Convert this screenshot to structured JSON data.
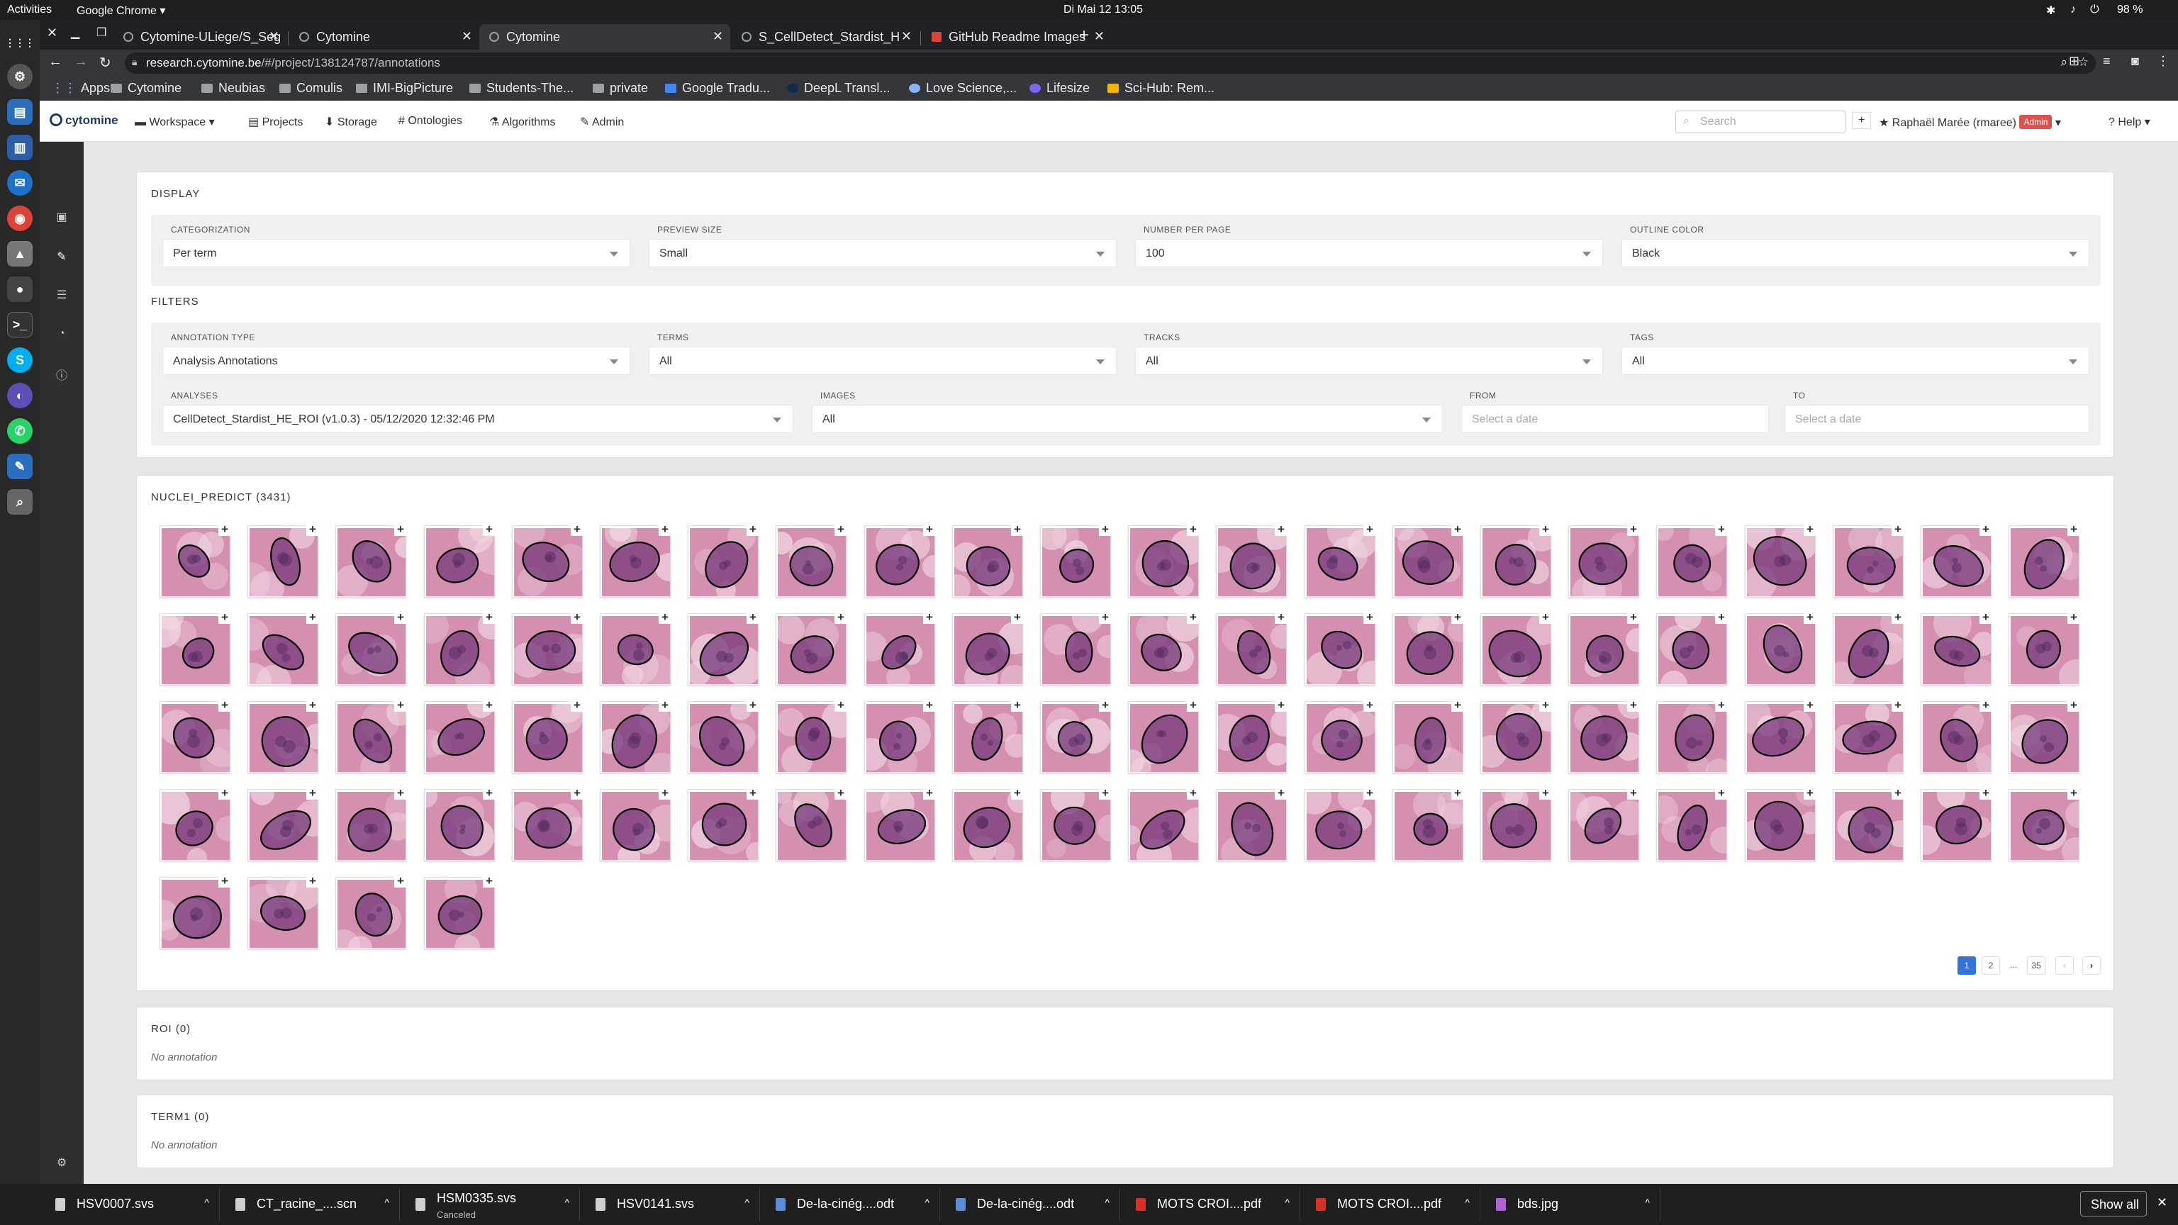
{
  "system_bar": {
    "activities": "Activities",
    "app": "Google Chrome",
    "clock": "Di Mai 12  13:05",
    "battery": "98 %"
  },
  "dock": {
    "icons": [
      "launcher-icon",
      "settings-icon",
      "files-icon",
      "thunderbird-icon",
      "chrome-icon",
      "inkscape-icon",
      "maps-icon",
      "terminal-icon",
      "skype-icon",
      "eclipse-icon",
      "whatsapp-icon",
      "editor-icon",
      "screenshot-icon"
    ]
  },
  "tabs": [
    {
      "title": "Cytomine-ULiege/S_Seg",
      "active": false
    },
    {
      "title": "Cytomine",
      "active": false
    },
    {
      "title": "Cytomine",
      "active": true
    },
    {
      "title": "S_CellDetect_Stardist_H",
      "active": false
    },
    {
      "title": "GitHub Readme Images",
      "active": false
    }
  ],
  "url": {
    "host": "research.cytomine.be",
    "path": "/#/project/138124787/annotations"
  },
  "bookmarks": [
    "Apps",
    "Cytomine",
    "Neubias",
    "Comulis",
    "IMI-BigPicture",
    "Students-The...",
    "private",
    "Google Tradu...",
    "DeepL Transl...",
    "Love Science,...",
    "Lifesize",
    "Sci-Hub: Rem..."
  ],
  "navbar": {
    "logo": "cytomine",
    "items": [
      "Workspace",
      "Projects",
      "Storage",
      "Ontologies",
      "Algorithms",
      "Admin"
    ],
    "search_placeholder": "Search",
    "user": "Raphaël Marée (rmaree)",
    "admin_badge": "Admin",
    "help": "Help"
  },
  "display": {
    "title": "DISPLAY",
    "categorization": {
      "label": "CATEGORIZATION",
      "value": "Per term"
    },
    "preview_size": {
      "label": "PREVIEW SIZE",
      "value": "Small"
    },
    "number_per_page": {
      "label": "NUMBER PER PAGE",
      "value": "100"
    },
    "outline_color": {
      "label": "OUTLINE COLOR",
      "value": "Black"
    }
  },
  "filters": {
    "title": "FILTERS",
    "annotation_type": {
      "label": "ANNOTATION TYPE",
      "value": "Analysis Annotations"
    },
    "terms": {
      "label": "TERMS",
      "value": "All"
    },
    "tracks": {
      "label": "TRACKS",
      "value": "All"
    },
    "tags": {
      "label": "TAGS",
      "value": "All"
    },
    "analyses": {
      "label": "ANALYSES",
      "value": "CellDetect_Stardist_HE_ROI (v1.0.3) - 05/12/2020 12:32:46 PM"
    },
    "images": {
      "label": "IMAGES",
      "value": "All"
    },
    "from": {
      "label": "FROM",
      "placeholder": "Select a date"
    },
    "to": {
      "label": "TO",
      "placeholder": "Select a date"
    }
  },
  "nuclei": {
    "title": "NUCLEI_PREDICT (3431)",
    "thumbnail_count": 92,
    "pagination": [
      "1",
      "2",
      "...",
      "35"
    ]
  },
  "roi": {
    "title": "ROI (0)",
    "empty": "No annotation"
  },
  "term1": {
    "title": "TERM1 (0)",
    "empty": "No annotation"
  },
  "downloads": [
    {
      "name": "HSV0007.svs",
      "status": ""
    },
    {
      "name": "CT_racine_....scn",
      "status": ""
    },
    {
      "name": "HSM0335.svs",
      "status": "Canceled"
    },
    {
      "name": "HSV0141.svs",
      "status": ""
    },
    {
      "name": "De-la-cinég....odt",
      "status": ""
    },
    {
      "name": "De-la-cinég....odt",
      "status": ""
    },
    {
      "name": "MOTS CROI....pdf",
      "status": ""
    },
    {
      "name": "MOTS CROI....pdf",
      "status": ""
    },
    {
      "name": "bds.jpg",
      "status": ""
    }
  ],
  "show_all": "Show all",
  "colors": {
    "tissue_light": "#d58fb0",
    "tissue_dark": "#a04f86",
    "nucleus": "#7a3d7e",
    "outline": "#000000",
    "accent": "#3273dc"
  }
}
